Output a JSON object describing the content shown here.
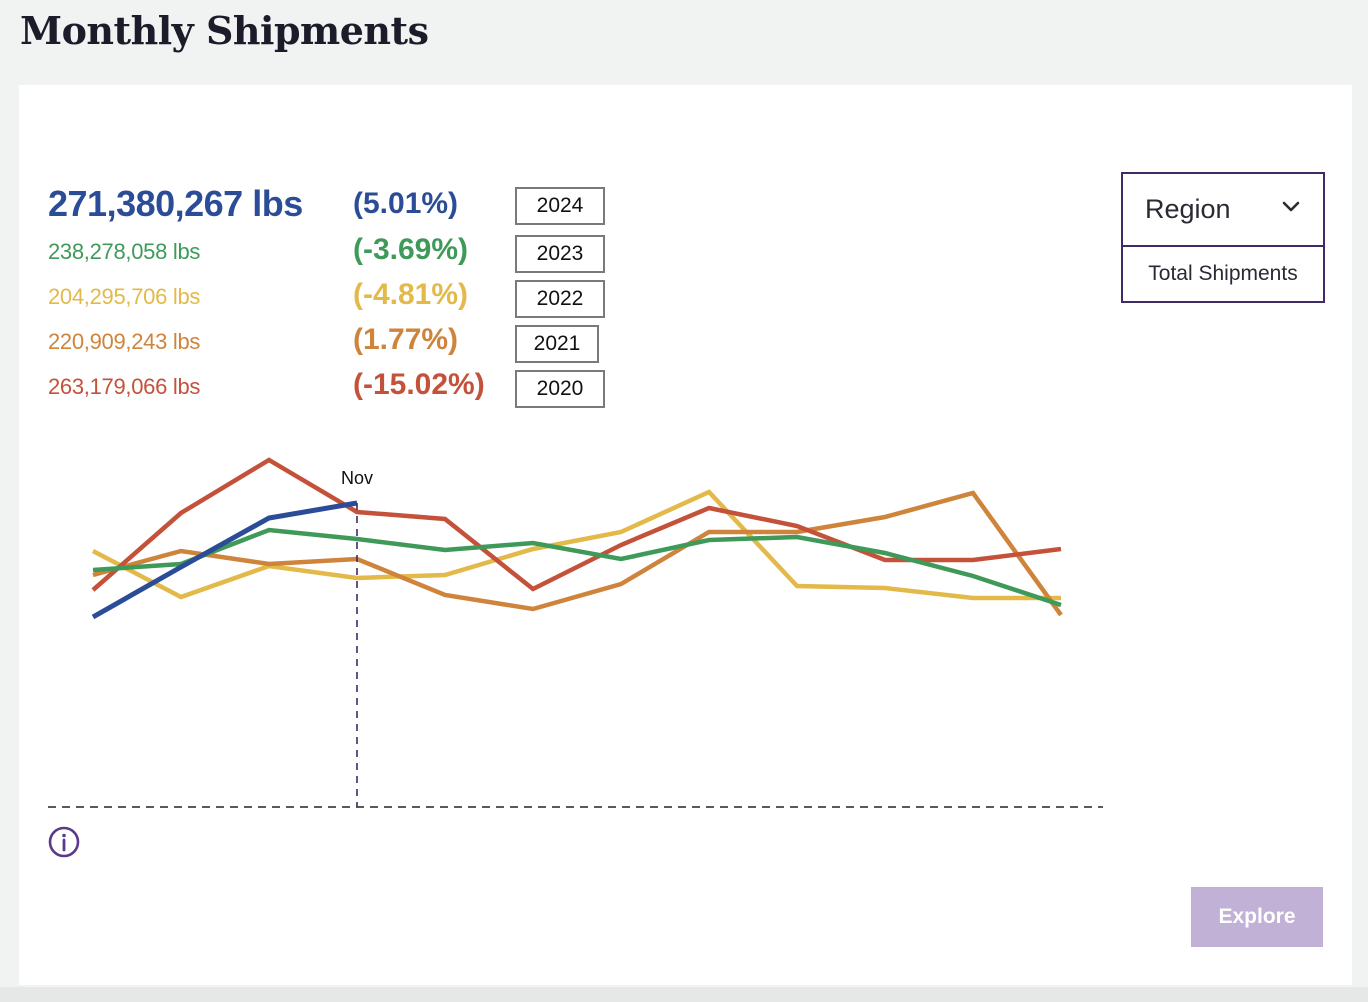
{
  "header": {
    "title": "Monthly Shipments"
  },
  "summary": [
    {
      "year": "2024",
      "value": "271,380,267 lbs",
      "change": "(5.01%)",
      "color": "#2b4c96",
      "primary": true
    },
    {
      "year": "2023",
      "value": "238,278,058 lbs",
      "change": "(-3.69%)",
      "color": "#3f9a5a",
      "primary": false
    },
    {
      "year": "2022",
      "value": "204,295,706 lbs",
      "change": "(-4.81%)",
      "color": "#e3b94a",
      "primary": false
    },
    {
      "year": "2021",
      "value": "220,909,243 lbs",
      "change": "(1.77%)",
      "color": "#cf843c",
      "primary": false
    },
    {
      "year": "2020",
      "value": "263,179,066 lbs",
      "change": "(-15.02%)",
      "color": "#c4523a",
      "primary": false
    }
  ],
  "filter": {
    "selected": "Region",
    "icon": "chevron-down-icon",
    "options": [
      "Total Shipments"
    ]
  },
  "actions": {
    "explore_label": "Explore",
    "info_icon": "info-icon"
  },
  "colors": {
    "accent": "#3f2a66",
    "explore_bg": "#c2b1d6",
    "marker": "#3f2a66"
  },
  "chart_data": {
    "type": "line",
    "title": "Monthly Shipments",
    "xlabel": "",
    "ylabel": "",
    "x_count": 12,
    "highlight": {
      "index": 3,
      "label": "Nov"
    },
    "ylim": [
      0,
      400
    ],
    "grid": false,
    "baseline_dashed": true,
    "legend": "top-left",
    "series": [
      {
        "name": "2020",
        "color": "#c4523a",
        "values": [
          217,
          294,
          347,
          295,
          288,
          218,
          262,
          299,
          281,
          247,
          247,
          258
        ]
      },
      {
        "name": "2021",
        "color": "#cf843c",
        "values": [
          232,
          256,
          243,
          248,
          212,
          198,
          223,
          275,
          275,
          290,
          314,
          192
        ]
      },
      {
        "name": "2022",
        "color": "#e3b94a",
        "values": [
          256,
          210,
          241,
          229,
          232,
          258,
          275,
          315,
          221,
          219,
          209,
          209
        ]
      },
      {
        "name": "2023",
        "color": "#3f9a5a",
        "values": [
          237,
          243,
          277,
          268,
          257,
          264,
          248,
          267,
          270,
          254,
          231,
          202
        ]
      },
      {
        "name": "2024",
        "color": "#2b4c96",
        "values": [
          190,
          240,
          289,
          304
        ]
      }
    ]
  }
}
